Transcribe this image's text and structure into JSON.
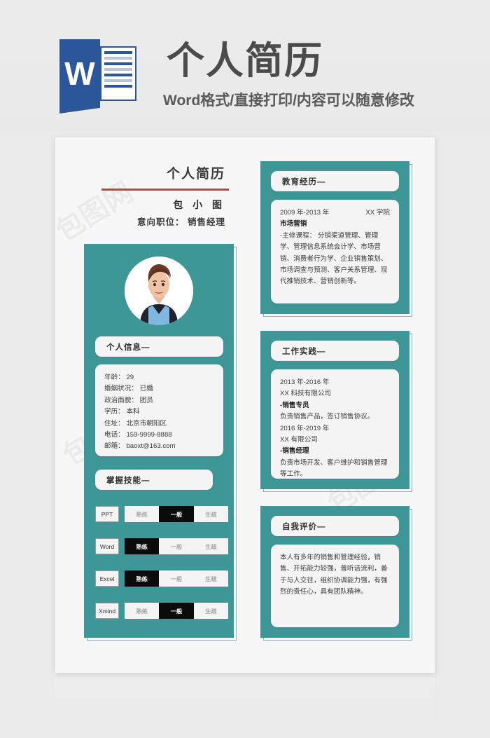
{
  "banner": {
    "title": "个人简历",
    "subtitle": "Word格式/直接打印/内容可以随意修改",
    "logo_letter": "W",
    "logo_name": "word-icon"
  },
  "resume": {
    "title": "个人简历",
    "name": "包 小 图",
    "position_line": "意向职位： 销售经理"
  },
  "personal_info": {
    "header": "个人信息—",
    "rows": [
      "年龄： 29",
      "婚姻状况： 已婚",
      "政治面貌： 团员",
      "学历： 本科",
      "住址： 北京市朝阳区",
      "电话： 159-9999-8888",
      "邮箱： baoxt@163.com"
    ]
  },
  "skills": {
    "header": "掌握技能—",
    "levels": [
      "熟练",
      "一般",
      "生疏"
    ],
    "items": [
      {
        "name": "PPT",
        "level": "一般"
      },
      {
        "name": "Word",
        "level": "熟练"
      },
      {
        "name": "Excel",
        "level": "熟练"
      },
      {
        "name": "Xmind",
        "level": "一般"
      }
    ]
  },
  "education": {
    "header": "教育经历—",
    "period": "2009 年-2013 年",
    "school": "XX 学院",
    "major": "市场营销",
    "courses": "-主修课程： 分销渠道管理、管理学、管理信息系统会计学、市场营销、消费者行为学、企业销售策划、市场调查与预测、客户关系管理、现代推销技术、营销创新等。"
  },
  "work": {
    "header": "工作实践—",
    "entries": [
      {
        "period": "2013 年-2016 年",
        "company": "XX 科技有限公司",
        "role": "-销售专员",
        "desc": "负责销售产品，签订销售协议。"
      },
      {
        "period": "2016 年-2019 年",
        "company": "XX 有限公司",
        "role": "-销售经理",
        "desc": "负责市场开发、客户维护和销售管理等工作。"
      }
    ]
  },
  "self_eval": {
    "header": "自我评价—",
    "text": "本人有多年的销售和管理经验，销售、开拓能力较强，普听话流利，善于与人交往，组织协调能力强，有强烈的责任心，具有团队精神。"
  },
  "colors": {
    "teal": "#3d9796",
    "teal_outline": "#7fb9b7",
    "accent_red": "#c0453f",
    "word_blue": "#2b579a",
    "card_bg": "#f4f4f4",
    "paper_bg": "#f7f7f7",
    "page_bg": "#ebebeb",
    "highlight": "#0b0b0b"
  },
  "watermarks": [
    "包图网",
    "包图网",
    "包图网"
  ]
}
